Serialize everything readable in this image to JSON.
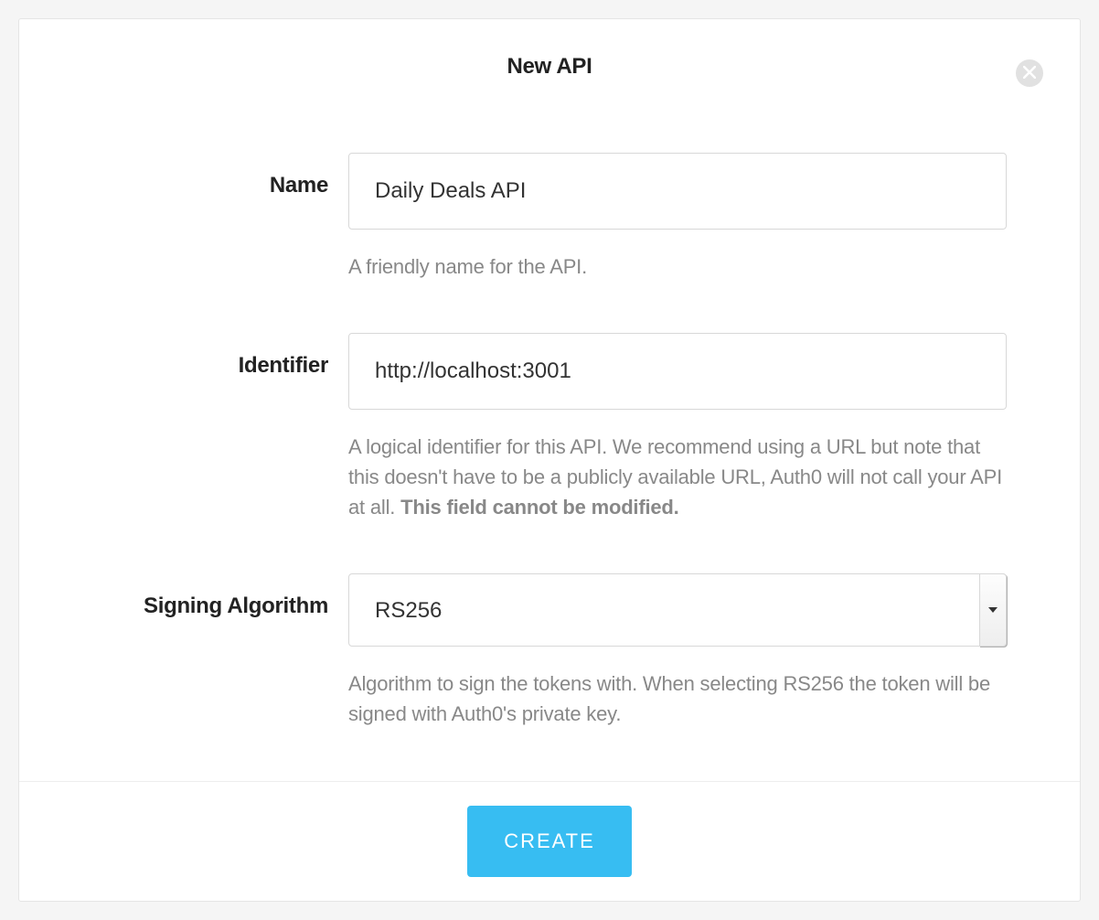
{
  "modal": {
    "title": "New API",
    "create_label": "CREATE"
  },
  "form": {
    "name": {
      "label": "Name",
      "value": "Daily Deals API",
      "help": "A friendly name for the API."
    },
    "identifier": {
      "label": "Identifier",
      "value": "http://localhost:3001",
      "help_pre": "A logical identifier for this API. We recommend using a URL but note that this doesn't have to be a publicly available URL, Auth0 will not call your API at all. ",
      "help_bold": "This field cannot be modified."
    },
    "signing": {
      "label": "Signing Algorithm",
      "value": "RS256",
      "help": "Algorithm to sign the tokens with. When selecting RS256 the token will be signed with Auth0's private key."
    }
  }
}
